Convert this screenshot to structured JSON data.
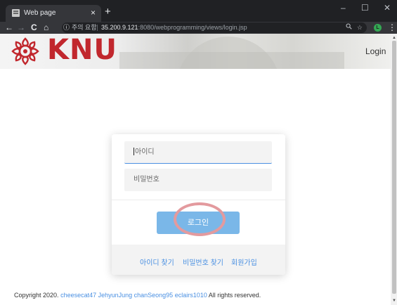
{
  "browser": {
    "tab_title": "Web page",
    "tab_close": "×",
    "new_tab": "+",
    "window_controls": {
      "minimize": "–",
      "maximize": "☐",
      "close": "✕"
    },
    "nav": {
      "back": "←",
      "forward": "→",
      "reload": "C",
      "home": "⌂"
    },
    "security_icon": "ⓘ",
    "security_label": "주의 요함",
    "url_host": "35.200.9.121",
    "url_rest": ":8080/webprogramming/views/login.jsp",
    "zoom_icon": "search-icon",
    "profile_initial": "L",
    "menu": "⋮"
  },
  "header": {
    "logo_text": "KNU",
    "login_link": "Login"
  },
  "form": {
    "id_placeholder": "아이디",
    "password_placeholder": "비밀번호",
    "submit_label": "로그인",
    "links": {
      "find_id": "아이디 찾기",
      "find_password": "비밀번호 찾기",
      "signup": "회원가입"
    }
  },
  "footer": {
    "prefix": "Copyright 2020.",
    "authors": "cheesecat47 JehyunJung chanSeong95 eclairs1010",
    "suffix": "All rights reserved."
  },
  "colors": {
    "brand_red": "#c1272d",
    "accent_blue": "#4a90e2",
    "button_blue": "#7ab7e8",
    "annotation_ring": "#e39a9e"
  }
}
